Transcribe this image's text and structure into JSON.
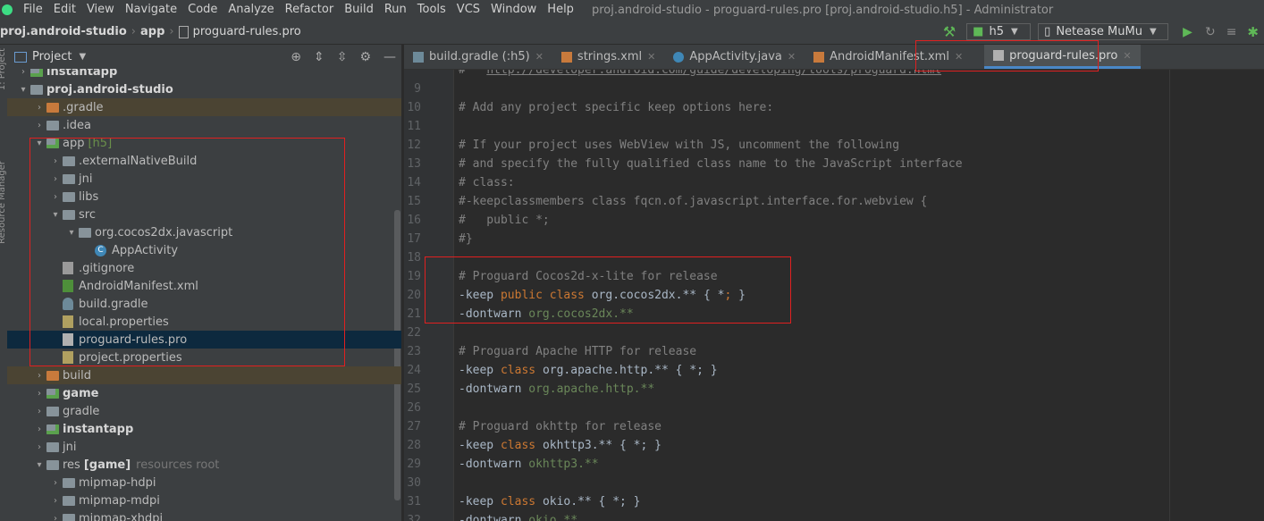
{
  "menubar": {
    "items": [
      "File",
      "Edit",
      "View",
      "Navigate",
      "Code",
      "Analyze",
      "Refactor",
      "Build",
      "Run",
      "Tools",
      "VCS",
      "Window",
      "Help"
    ],
    "window_title": "proj.android-studio - proguard-rules.pro [proj.android-studio.h5] - Administrator"
  },
  "navbar": {
    "breadcrumbs": [
      "proj.android-studio",
      "app",
      "proguard-rules.pro"
    ],
    "run_config": "h5",
    "device": "Netease MuMu"
  },
  "project_panel": {
    "title": "Project",
    "tree": [
      {
        "label": "instantapp",
        "depth": 1,
        "arrow": "›",
        "icon": "module",
        "bold": true
      },
      {
        "label": "proj.android-studio",
        "depth": 1,
        "arrow": "⌄",
        "icon": "folder",
        "bold": true
      },
      {
        "label": ".gradle",
        "depth": 2,
        "arrow": "›",
        "icon": "orange",
        "highlight": true,
        "color": "orange"
      },
      {
        "label": ".idea",
        "depth": 2,
        "arrow": "›",
        "icon": "folder"
      },
      {
        "label": "app",
        "suffix": "[h5]",
        "depth": 2,
        "arrow": "⌄",
        "icon": "module"
      },
      {
        "label": ".externalNativeBuild",
        "depth": 3,
        "arrow": "›",
        "icon": "folder"
      },
      {
        "label": "jni",
        "depth": 3,
        "arrow": "›",
        "icon": "folder"
      },
      {
        "label": "libs",
        "depth": 3,
        "arrow": "›",
        "icon": "folder"
      },
      {
        "label": "src",
        "depth": 3,
        "arrow": "⌄",
        "icon": "folder"
      },
      {
        "label": "org.cocos2dx.javascript",
        "depth": 4,
        "arrow": "⌄",
        "icon": "pkg"
      },
      {
        "label": "AppActivity",
        "depth": 5,
        "arrow": "",
        "icon": "c"
      },
      {
        "label": ".gitignore",
        "depth": 3,
        "arrow": "",
        "icon": "git"
      },
      {
        "label": "AndroidManifest.xml",
        "depth": 3,
        "arrow": "",
        "icon": "xml"
      },
      {
        "label": "build.gradle",
        "depth": 3,
        "arrow": "",
        "icon": "gradle"
      },
      {
        "label": "local.properties",
        "depth": 3,
        "arrow": "",
        "icon": "props"
      },
      {
        "label": "proguard-rules.pro",
        "depth": 3,
        "arrow": "",
        "icon": "pro",
        "selected": true
      },
      {
        "label": "project.properties",
        "depth": 3,
        "arrow": "",
        "icon": "props"
      },
      {
        "label": "build",
        "depth": 2,
        "arrow": "›",
        "icon": "orange",
        "highlight": true,
        "color": "orange"
      },
      {
        "label": "game",
        "depth": 2,
        "arrow": "›",
        "icon": "module",
        "bold": true
      },
      {
        "label": "gradle",
        "depth": 2,
        "arrow": "›",
        "icon": "folder"
      },
      {
        "label": "instantapp",
        "depth": 2,
        "arrow": "›",
        "icon": "module",
        "bold": true
      },
      {
        "label": "jni",
        "depth": 2,
        "arrow": "›",
        "icon": "folder"
      },
      {
        "label": "res",
        "suffix_bold": "[game]",
        "suffix": "resources root",
        "depth": 2,
        "arrow": "⌄",
        "icon": "folder"
      },
      {
        "label": "mipmap-hdpi",
        "depth": 3,
        "arrow": "›",
        "icon": "folder"
      },
      {
        "label": "mipmap-mdpi",
        "depth": 3,
        "arrow": "›",
        "icon": "folder"
      },
      {
        "label": "mipmap-xhdpi",
        "depth": 3,
        "arrow": "›",
        "icon": "folder"
      }
    ]
  },
  "editor_tabs": [
    {
      "label": "build.gradle (:h5)",
      "icon": "gradle"
    },
    {
      "label": "strings.xml",
      "icon": "xml"
    },
    {
      "label": "AppActivity.java",
      "icon": "c"
    },
    {
      "label": "AndroidManifest.xml",
      "icon": "xml"
    },
    {
      "label": "proguard-rules.pro",
      "icon": "pro",
      "active": true
    }
  ],
  "code": {
    "lines": [
      {
        "n": "",
        "seg": [
          [
            "t-comment",
            "#   "
          ],
          [
            "t-link",
            "http://developer.android.com/guide/developing/tools/proguard.html"
          ]
        ]
      },
      {
        "n": "9",
        "seg": []
      },
      {
        "n": "10",
        "seg": [
          [
            "t-comment",
            "# Add any project specific keep options here:"
          ]
        ]
      },
      {
        "n": "11",
        "seg": []
      },
      {
        "n": "12",
        "seg": [
          [
            "t-comment",
            "# If your project uses WebView with JS, uncomment the following"
          ]
        ]
      },
      {
        "n": "13",
        "seg": [
          [
            "t-comment",
            "# and specify the fully qualified class name to the JavaScript interface"
          ]
        ]
      },
      {
        "n": "14",
        "seg": [
          [
            "t-comment",
            "# class:"
          ]
        ]
      },
      {
        "n": "15",
        "seg": [
          [
            "t-comment",
            "#-keepclassmembers class fqcn.of.javascript.interface.for.webview {"
          ]
        ]
      },
      {
        "n": "16",
        "seg": [
          [
            "t-comment",
            "#   public *;"
          ]
        ]
      },
      {
        "n": "17",
        "seg": [
          [
            "t-comment",
            "#}"
          ]
        ]
      },
      {
        "n": "18",
        "seg": []
      },
      {
        "n": "19",
        "seg": [
          [
            "t-comment",
            "# Proguard Cocos2d-x-lite for release"
          ]
        ]
      },
      {
        "n": "20",
        "seg": [
          [
            "t-plain",
            "-keep "
          ],
          [
            "t-kw",
            "public class "
          ],
          [
            "t-plain",
            "org.cocos2dx.** { *"
          ],
          [
            "t-kw",
            "; "
          ],
          [
            "t-plain",
            "}"
          ]
        ]
      },
      {
        "n": "21",
        "seg": [
          [
            "t-plain",
            "-dontwarn "
          ],
          [
            "t-green",
            "org.cocos2dx.**"
          ]
        ]
      },
      {
        "n": "22",
        "seg": []
      },
      {
        "n": "23",
        "seg": [
          [
            "t-comment",
            "# Proguard Apache HTTP for release"
          ]
        ]
      },
      {
        "n": "24",
        "seg": [
          [
            "t-plain",
            "-keep "
          ],
          [
            "t-kw",
            "class "
          ],
          [
            "t-plain",
            "org.apache.http.** { *; }"
          ]
        ]
      },
      {
        "n": "25",
        "seg": [
          [
            "t-plain",
            "-dontwarn "
          ],
          [
            "t-green",
            "org.apache.http.**"
          ]
        ]
      },
      {
        "n": "26",
        "seg": []
      },
      {
        "n": "27",
        "seg": [
          [
            "t-comment",
            "# Proguard okhttp for release"
          ]
        ]
      },
      {
        "n": "28",
        "seg": [
          [
            "t-plain",
            "-keep "
          ],
          [
            "t-kw",
            "class "
          ],
          [
            "t-plain",
            "okhttp3.** { *; }"
          ]
        ]
      },
      {
        "n": "29",
        "seg": [
          [
            "t-plain",
            "-dontwarn "
          ],
          [
            "t-green",
            "okhttp3.**"
          ]
        ]
      },
      {
        "n": "30",
        "seg": []
      },
      {
        "n": "31",
        "seg": [
          [
            "t-plain",
            "-keep "
          ],
          [
            "t-kw",
            "class "
          ],
          [
            "t-plain",
            "okio.** { *; }"
          ]
        ]
      },
      {
        "n": "32",
        "seg": [
          [
            "t-plain",
            "-dontwarn "
          ],
          [
            "t-green",
            "okio.**"
          ]
        ]
      }
    ]
  },
  "side_tabs": [
    "1: Project",
    "Resource Manager"
  ]
}
